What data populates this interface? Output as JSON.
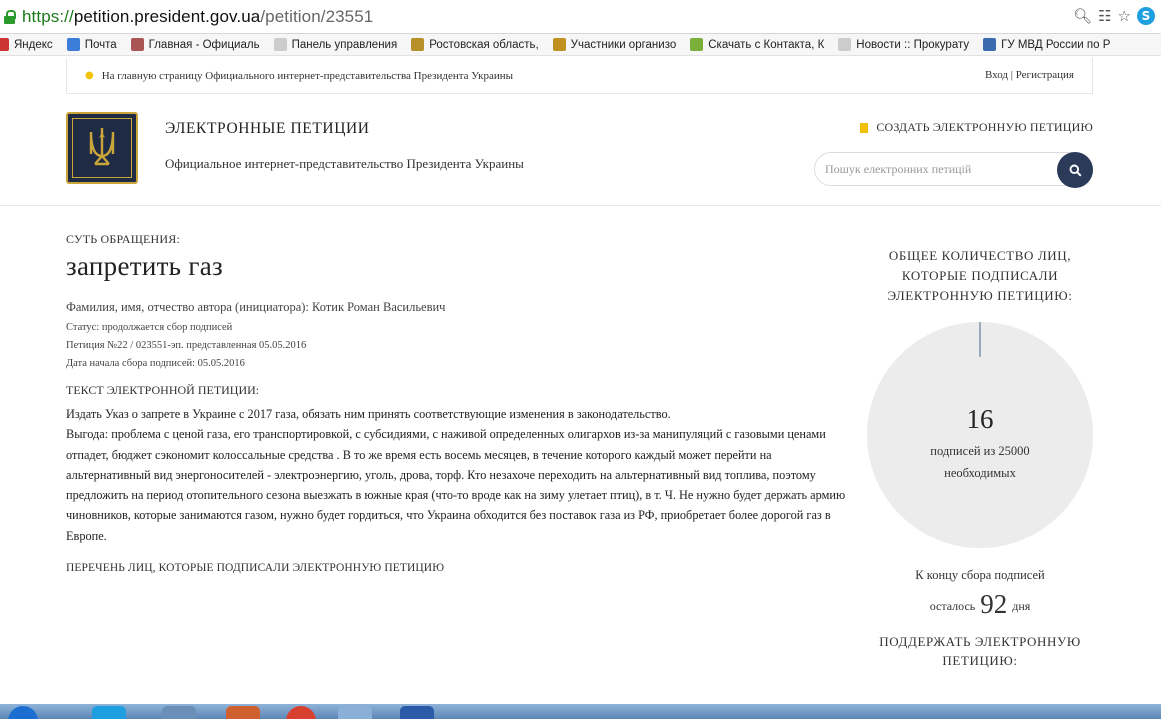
{
  "browser": {
    "url_scheme": "https://",
    "url_host": "petition.president.gov.ua",
    "url_path": "/petition/23551",
    "bookmarks": [
      {
        "label": "Яндекс",
        "color": "#c33"
      },
      {
        "label": "Почта",
        "color": "#3b7dd8"
      },
      {
        "label": "Главная - Официаль",
        "color": "#a55"
      },
      {
        "label": "Панель управления",
        "color": "#ccc"
      },
      {
        "label": "Ростовская область,",
        "color": "#b8902a"
      },
      {
        "label": "Участники организо",
        "color": "#c09020"
      },
      {
        "label": "Скачать с Контакта, К",
        "color": "#7ab03a"
      },
      {
        "label": "Новости :: Прокурату",
        "color": "#ccc"
      },
      {
        "label": "ГУ МВД России по Р",
        "color": "#3a6ab0"
      }
    ]
  },
  "topstrip": {
    "home_link": "На главную страницу Официального интернет-представительства Президента Украины",
    "login": "Вход",
    "register": "Регистрация"
  },
  "header": {
    "title": "ЭЛЕКТРОННЫЕ ПЕТИЦИИ",
    "subtitle": "Официальное интернет-представительство Президента Украины",
    "create_link": "СОЗДАТЬ ЭЛЕКТРОННУЮ ПЕТИЦИЮ",
    "search_placeholder": "Пошук електронних петицій"
  },
  "petition": {
    "essence_label": "СУТЬ ОБРАЩЕНИЯ:",
    "title": "запретить газ",
    "author": "Фамилия, имя, отчество автора (инициатора): Котик Роман Васильевич",
    "status": "Статус: продолжается сбор подписей",
    "number": "Петиция №22 / 023551-эп. представленная 05.05.2016",
    "start_date": "Дата начала сбора подписей: 05.05.2016",
    "text_label": "ТЕКСТ ЭЛЕКТРОННОЙ ПЕТИЦИИ:",
    "text_line1": "Издать Указ о запрете в Украине с 2017 газа, обязать ним принять соответствующие изменения в законодательство.",
    "text_body": "Выгода: проблема с ценой газа, его транспортировкой, с субсидиями, с наживой определенных олигархов из-за манипуляций с газовыми ценами отпадет, бюджет сэкономит колоссальные средства . В то же время есть восемь месяцев, в течение которого каждый может перейти на альтернативный вид энергоносителей - электроэнергию, уголь, дрова, торф. Кто незахоче переходить на альтернативный вид топлива, поэтому предложить на период отопительного сезона выезжать в южные края (что-то вроде как на зиму улетает птиц), в т. Ч. Не нужно будет держать армию чиновников, которые занимаются газом, нужно будет гордиться, что Украина обходится без поставок газа из РФ, приобретает более дорогой газ в Европе.",
    "signers_link": "ПЕРЕЧЕНЬ ЛИЦ, КОТОРЫЕ ПОДПИСАЛИ ЭЛЕКТРОННУЮ ПЕТИЦИЮ"
  },
  "sidebar": {
    "heading": "ОБЩЕЕ КОЛИЧЕСТВО ЛИЦ, КОТОРЫЕ ПОДПИСАЛИ ЭЛЕКТРОННУЮ ПЕТИЦИЮ:",
    "count": "16",
    "count_sub1": "подписей из 25000",
    "count_sub2": "необходимых",
    "progress_fraction": 0.00064,
    "end_label": "К концу сбора подписей",
    "remain_prefix": "осталось",
    "remain_days": "92",
    "remain_suffix": "дня",
    "support_heading": "ПОДДЕРЖАТЬ ЭЛЕКТРОННУЮ ПЕТИЦИЮ:"
  },
  "colors": {
    "navy": "#2a3a58",
    "gold": "#c9a53a",
    "accent_yellow": "#f2c200"
  }
}
